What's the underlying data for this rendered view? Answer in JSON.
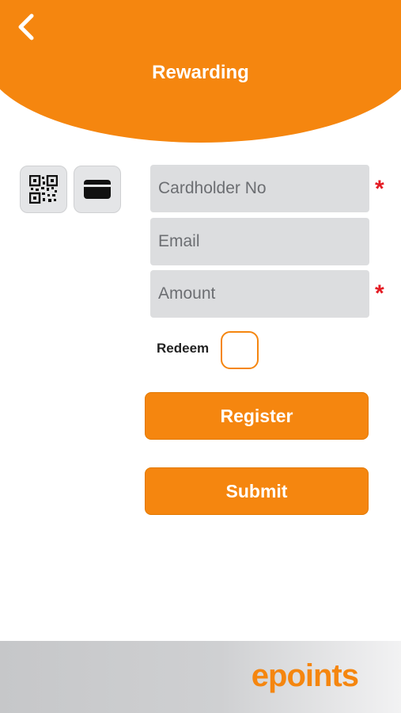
{
  "header": {
    "title": "Rewarding",
    "back_icon": "chevron-left-icon"
  },
  "scan_options": [
    {
      "icon": "qr-code-icon"
    },
    {
      "icon": "card-icon"
    }
  ],
  "form": {
    "cardholder_placeholder": "Cardholder No",
    "email_placeholder": "Email",
    "amount_placeholder": "Amount",
    "required_mark": "*",
    "redeem_label": "Redeem",
    "redeem_checked": false
  },
  "buttons": {
    "register": "Register",
    "submit": "Submit"
  },
  "footer": {
    "brand": "epoints"
  },
  "colors": {
    "accent": "#F5860F",
    "required": "#E41B23",
    "field_bg": "#DCDDDF"
  }
}
